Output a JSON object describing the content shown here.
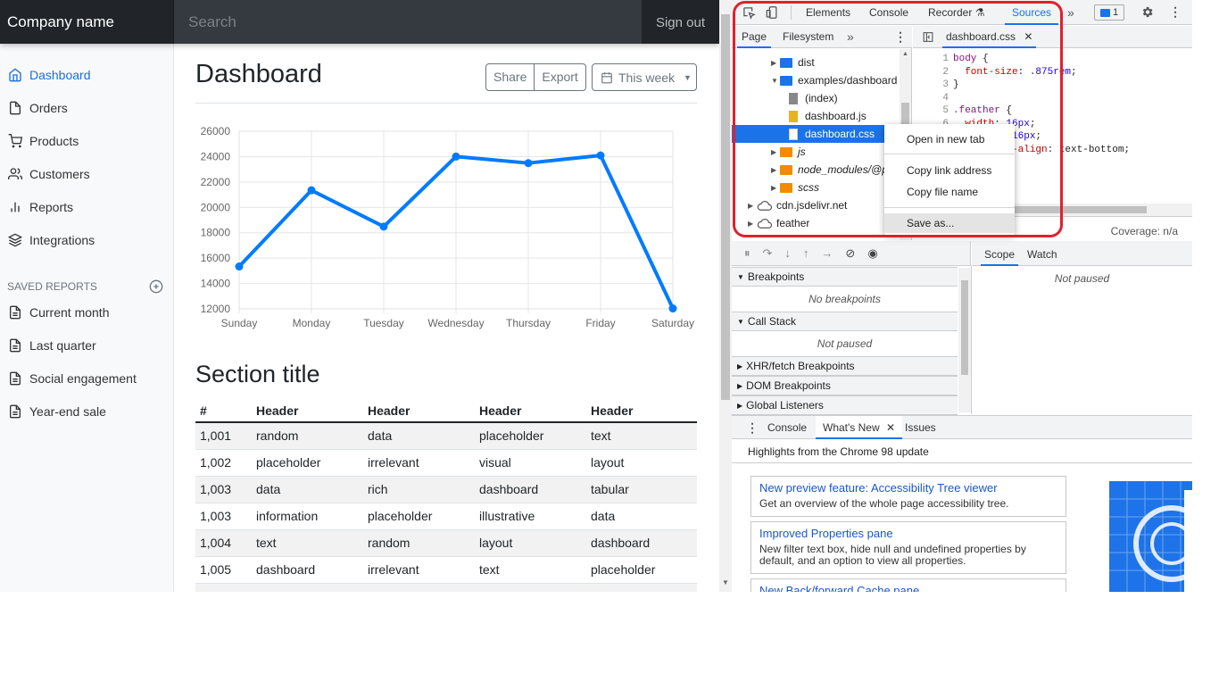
{
  "navbar": {
    "brand": "Company name",
    "search_placeholder": "Search",
    "signout": "Sign out"
  },
  "sidebar": {
    "items": [
      {
        "label": "Dashboard",
        "icon": "home-icon",
        "active": true
      },
      {
        "label": "Orders",
        "icon": "file-icon"
      },
      {
        "label": "Products",
        "icon": "cart-icon"
      },
      {
        "label": "Customers",
        "icon": "users-icon"
      },
      {
        "label": "Reports",
        "icon": "bar-chart-icon"
      },
      {
        "label": "Integrations",
        "icon": "layers-icon"
      }
    ],
    "saved_reports_heading": "SAVED REPORTS",
    "saved_reports": [
      "Current month",
      "Last quarter",
      "Social engagement",
      "Year-end sale"
    ]
  },
  "main": {
    "title": "Dashboard",
    "share_label": "Share",
    "export_label": "Export",
    "range_label": "This week",
    "section_title": "Section title"
  },
  "chart_data": {
    "type": "line",
    "categories": [
      "Sunday",
      "Monday",
      "Tuesday",
      "Wednesday",
      "Thursday",
      "Friday",
      "Saturday"
    ],
    "series": [
      {
        "values": [
          15339,
          21345,
          18483,
          24003,
          23489,
          24092,
          12034
        ],
        "color": "#007bff"
      }
    ],
    "yticks": [
      12000,
      14000,
      16000,
      18000,
      20000,
      22000,
      24000,
      26000
    ],
    "ylim": [
      12000,
      26000
    ],
    "grid": true,
    "legend": "none"
  },
  "table": {
    "headers": [
      "#",
      "Header",
      "Header",
      "Header",
      "Header"
    ],
    "rows": [
      [
        "1,001",
        "random",
        "data",
        "placeholder",
        "text"
      ],
      [
        "1,002",
        "placeholder",
        "irrelevant",
        "visual",
        "layout"
      ],
      [
        "1,003",
        "data",
        "rich",
        "dashboard",
        "tabular"
      ],
      [
        "1,003",
        "information",
        "placeholder",
        "illustrative",
        "data"
      ],
      [
        "1,004",
        "text",
        "random",
        "layout",
        "dashboard"
      ],
      [
        "1,005",
        "dashboard",
        "irrelevant",
        "text",
        "placeholder"
      ]
    ]
  },
  "devtools": {
    "tabs": [
      "Elements",
      "Console",
      "Recorder",
      "Sources"
    ],
    "selected_tab": "Sources",
    "issues_count": "1",
    "navigator_tabs": [
      "Page",
      "Filesystem"
    ],
    "tree": [
      {
        "label": "dist",
        "kind": "folder-blue",
        "indent": 2,
        "arrow": "▶"
      },
      {
        "label": "examples/dashboard",
        "kind": "folder-blue",
        "indent": 2,
        "arrow": "▼"
      },
      {
        "label": "(index)",
        "kind": "file-gray",
        "indent": 3
      },
      {
        "label": "dashboard.js",
        "kind": "file-yellow",
        "indent": 3
      },
      {
        "label": "dashboard.css",
        "kind": "file-white",
        "indent": 3,
        "selected": true
      },
      {
        "label": "js",
        "kind": "folder-orange",
        "indent": 2,
        "arrow": "▶",
        "italic": true
      },
      {
        "label": "node_modules/@p",
        "kind": "folder-orange",
        "indent": 2,
        "arrow": "▶",
        "italic": true
      },
      {
        "label": "scss",
        "kind": "folder-orange",
        "indent": 2,
        "arrow": "▶",
        "italic": true
      },
      {
        "label": "cdn.jsdelivr.net",
        "kind": "cloud",
        "indent": 1,
        "arrow": "▶"
      },
      {
        "label": "feather",
        "kind": "cloud",
        "indent": 1,
        "arrow": "▶"
      }
    ],
    "editor_tab": "dashboard.css",
    "code_lines": [
      {
        "n": "1",
        "html": "<span class='sel-k'>body</span> {"
      },
      {
        "n": "2",
        "html": "  <span class='prop'>font-size</span>: <span class='num'>.875rem</span>;"
      },
      {
        "n": "3",
        "html": "}"
      },
      {
        "n": "4",
        "html": ""
      },
      {
        "n": "5",
        "html": "<span class='sel-k'>.feather</span> {"
      },
      {
        "n": "6",
        "html": "  <span class='prop'>width</span>: <span class='num'>16px</span>;"
      },
      {
        "n": "7",
        "html": "  <span class='prop'>height</span>: <span class='num'>16px</span>;"
      },
      {
        "n": "8",
        "html": "  <span class='prop'>vertical-align</span>: text-bottom;"
      }
    ],
    "coverage": "Coverage: n/a",
    "context_menu": [
      "Open in new tab",
      "Copy link address",
      "Copy file name",
      "Save as..."
    ],
    "scope_tabs": [
      "Scope",
      "Watch"
    ],
    "not_paused": "Not paused",
    "sections": [
      {
        "title": "Breakpoints",
        "open": true,
        "body": "No breakpoints"
      },
      {
        "title": "Call Stack",
        "open": true,
        "body": "Not paused"
      },
      {
        "title": "XHR/fetch Breakpoints",
        "open": false
      },
      {
        "title": "DOM Breakpoints",
        "open": false
      },
      {
        "title": "Global Listeners",
        "open": false
      }
    ],
    "drawer_tabs": [
      "Console",
      "What's New",
      "Issues"
    ],
    "highlights": "Highlights from the Chrome 98 update",
    "whats_new": [
      {
        "title": "New preview feature: Accessibility Tree viewer",
        "desc": "Get an overview of the whole page accessibility tree."
      },
      {
        "title": "Improved Properties pane",
        "desc": "New filter text box, hide null and undefined properties by default, and an option to view all properties."
      },
      {
        "title": "New Back/forward Cache pane",
        "desc": ""
      }
    ]
  }
}
